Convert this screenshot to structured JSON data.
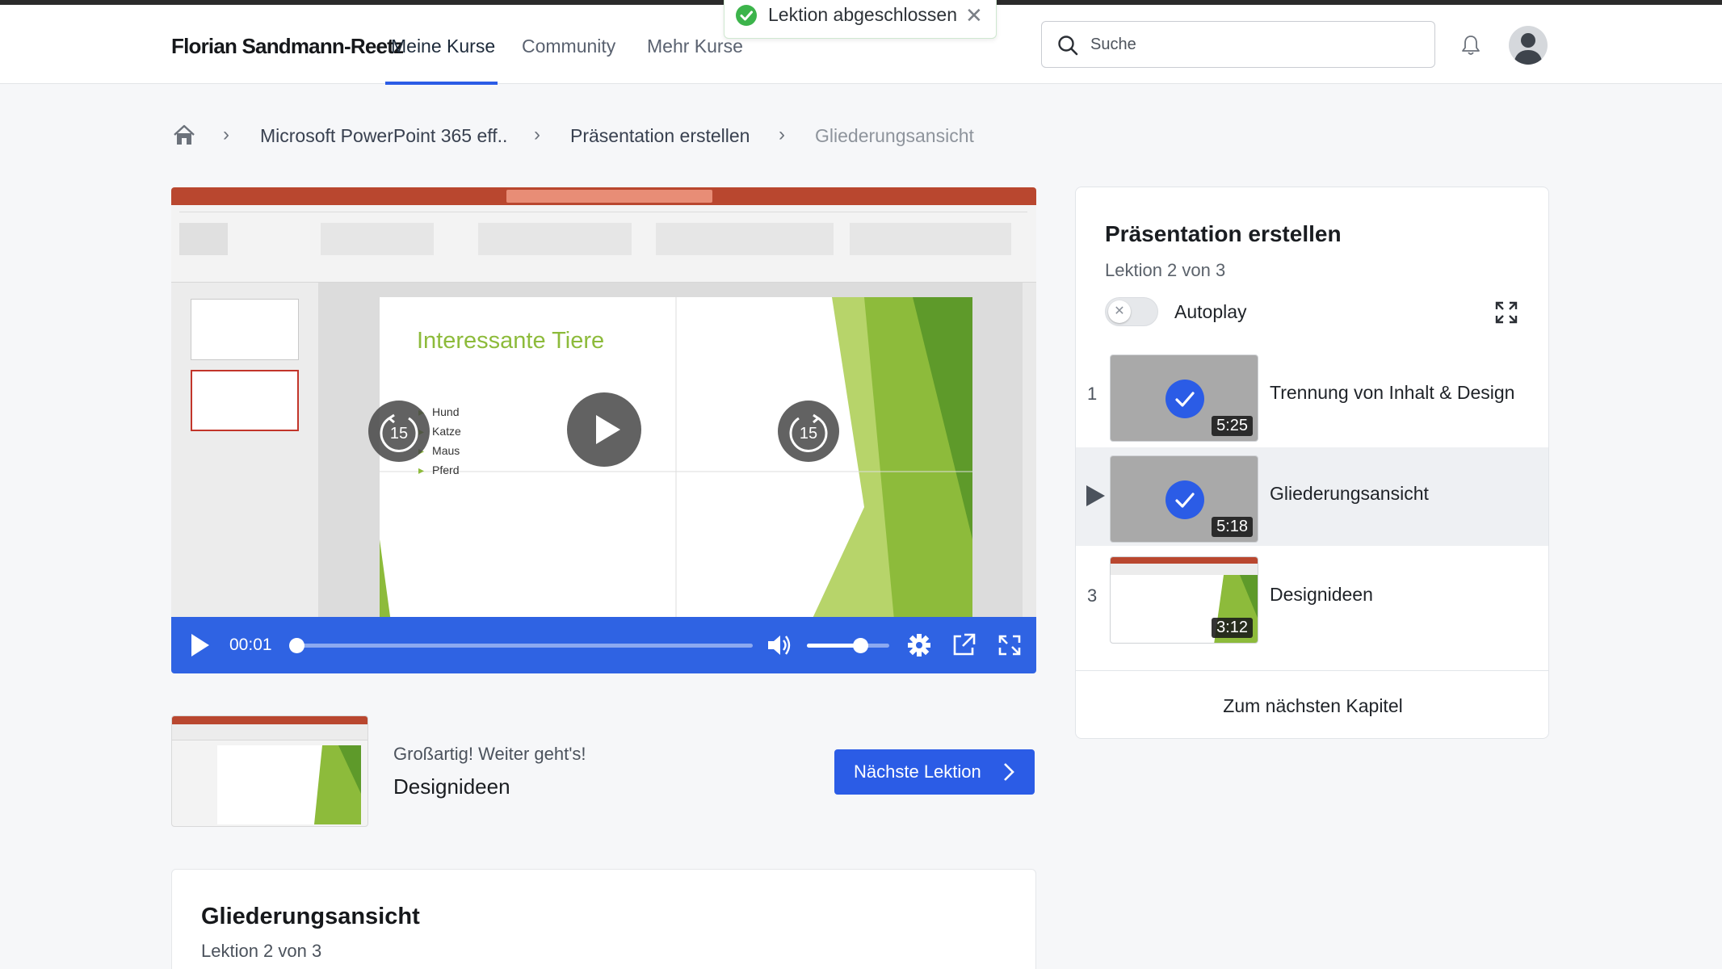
{
  "header": {
    "brand": "Florian Sandmann-Reetz",
    "nav": [
      {
        "label": "Meine Kurse",
        "active": true
      },
      {
        "label": "Community",
        "active": false
      },
      {
        "label": "Mehr Kurse",
        "active": false
      }
    ],
    "search": {
      "placeholder": "Suche",
      "value": ""
    },
    "icons": {
      "search": "search-icon",
      "notifications": "bell-icon",
      "avatar": "user-avatar"
    }
  },
  "toast": {
    "message": "Lektion abgeschlossen",
    "icon": "check-circle-icon",
    "color": "#3cb44b"
  },
  "breadcrumb": {
    "home_icon": "home-icon",
    "items": [
      "Microsoft PowerPoint 365 eff..",
      "Präsentation erstellen",
      "Gliederungsansicht"
    ]
  },
  "video": {
    "slide_title": "Interessante Tiere",
    "slide_bullets": [
      "Hund",
      "Katze",
      "Maus",
      "Pferd"
    ],
    "time": "00:01",
    "progress": 0.01,
    "volume": 0.65,
    "skip_back_label": "15",
    "skip_forward_label": "15",
    "controls_color": "#2f63e3"
  },
  "next": {
    "kicker": "Großartig! Weiter geht's!",
    "title": "Designideen",
    "button_label": "Nächste Lektion"
  },
  "lesson_card": {
    "title": "Gliederungsansicht",
    "subtitle": "Lektion 2 von 3"
  },
  "sidebar": {
    "title": "Präsentation erstellen",
    "subtitle": "Lektion 2 von 3",
    "autoplay_label": "Autoplay",
    "autoplay_on": false,
    "lessons": [
      {
        "num": "1",
        "title": "Trennung von Inhalt & Design",
        "duration": "5:25",
        "completed": true,
        "current": false
      },
      {
        "num": "2",
        "title": "Gliederungsansicht",
        "duration": "5:18",
        "completed": true,
        "current": true
      },
      {
        "num": "3",
        "title": "Designideen",
        "duration": "3:12",
        "completed": false,
        "current": false
      }
    ],
    "footer_button": "Zum nächsten Kapitel"
  },
  "colors": {
    "accent": "#2b5ce6",
    "success": "#3cb44b",
    "slide_green": "#8dbb3b"
  }
}
